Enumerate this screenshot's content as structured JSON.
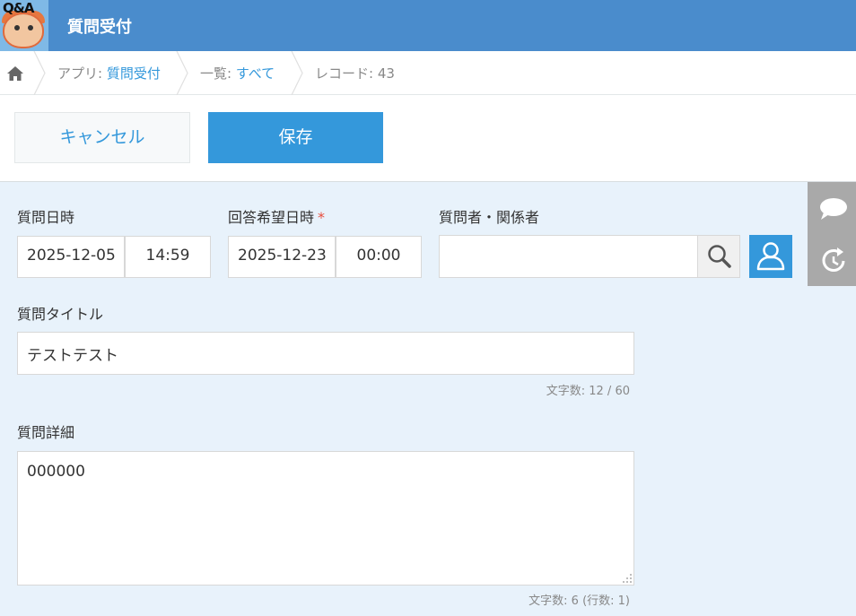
{
  "header": {
    "app_icon_text": "Q&A",
    "title": "質問受付"
  },
  "breadcrumb": {
    "app_prefix": "アプリ: ",
    "app_name": "質問受付",
    "list_prefix": "一覧: ",
    "list_name": "すべて",
    "record": "レコード: 43"
  },
  "toolbar": {
    "cancel_label": "キャンセル",
    "save_label": "保存"
  },
  "form": {
    "question_datetime": {
      "label": "質問日時",
      "date": "2025-12-05",
      "time": "14:59"
    },
    "desired_answer_datetime": {
      "label": "回答希望日時",
      "required_mark": "*",
      "date": "2025-12-23",
      "time": "00:00"
    },
    "questioner": {
      "label": "質問者・関係者",
      "value": ""
    },
    "question_title": {
      "label": "質問タイトル",
      "value": "テストテスト",
      "counter": "文字数: 12 / 60"
    },
    "question_detail": {
      "label": "質問詳細",
      "value": "000000",
      "counter": "文字数: 6 (行数: 1)"
    }
  },
  "colors": {
    "header": "#4a8ccc",
    "accent": "#3498db",
    "form_bg": "#e8f2fb",
    "required": "#e74c3c"
  },
  "icons": [
    "home-icon",
    "search-icon",
    "user-icon",
    "comment-icon",
    "history-icon"
  ]
}
